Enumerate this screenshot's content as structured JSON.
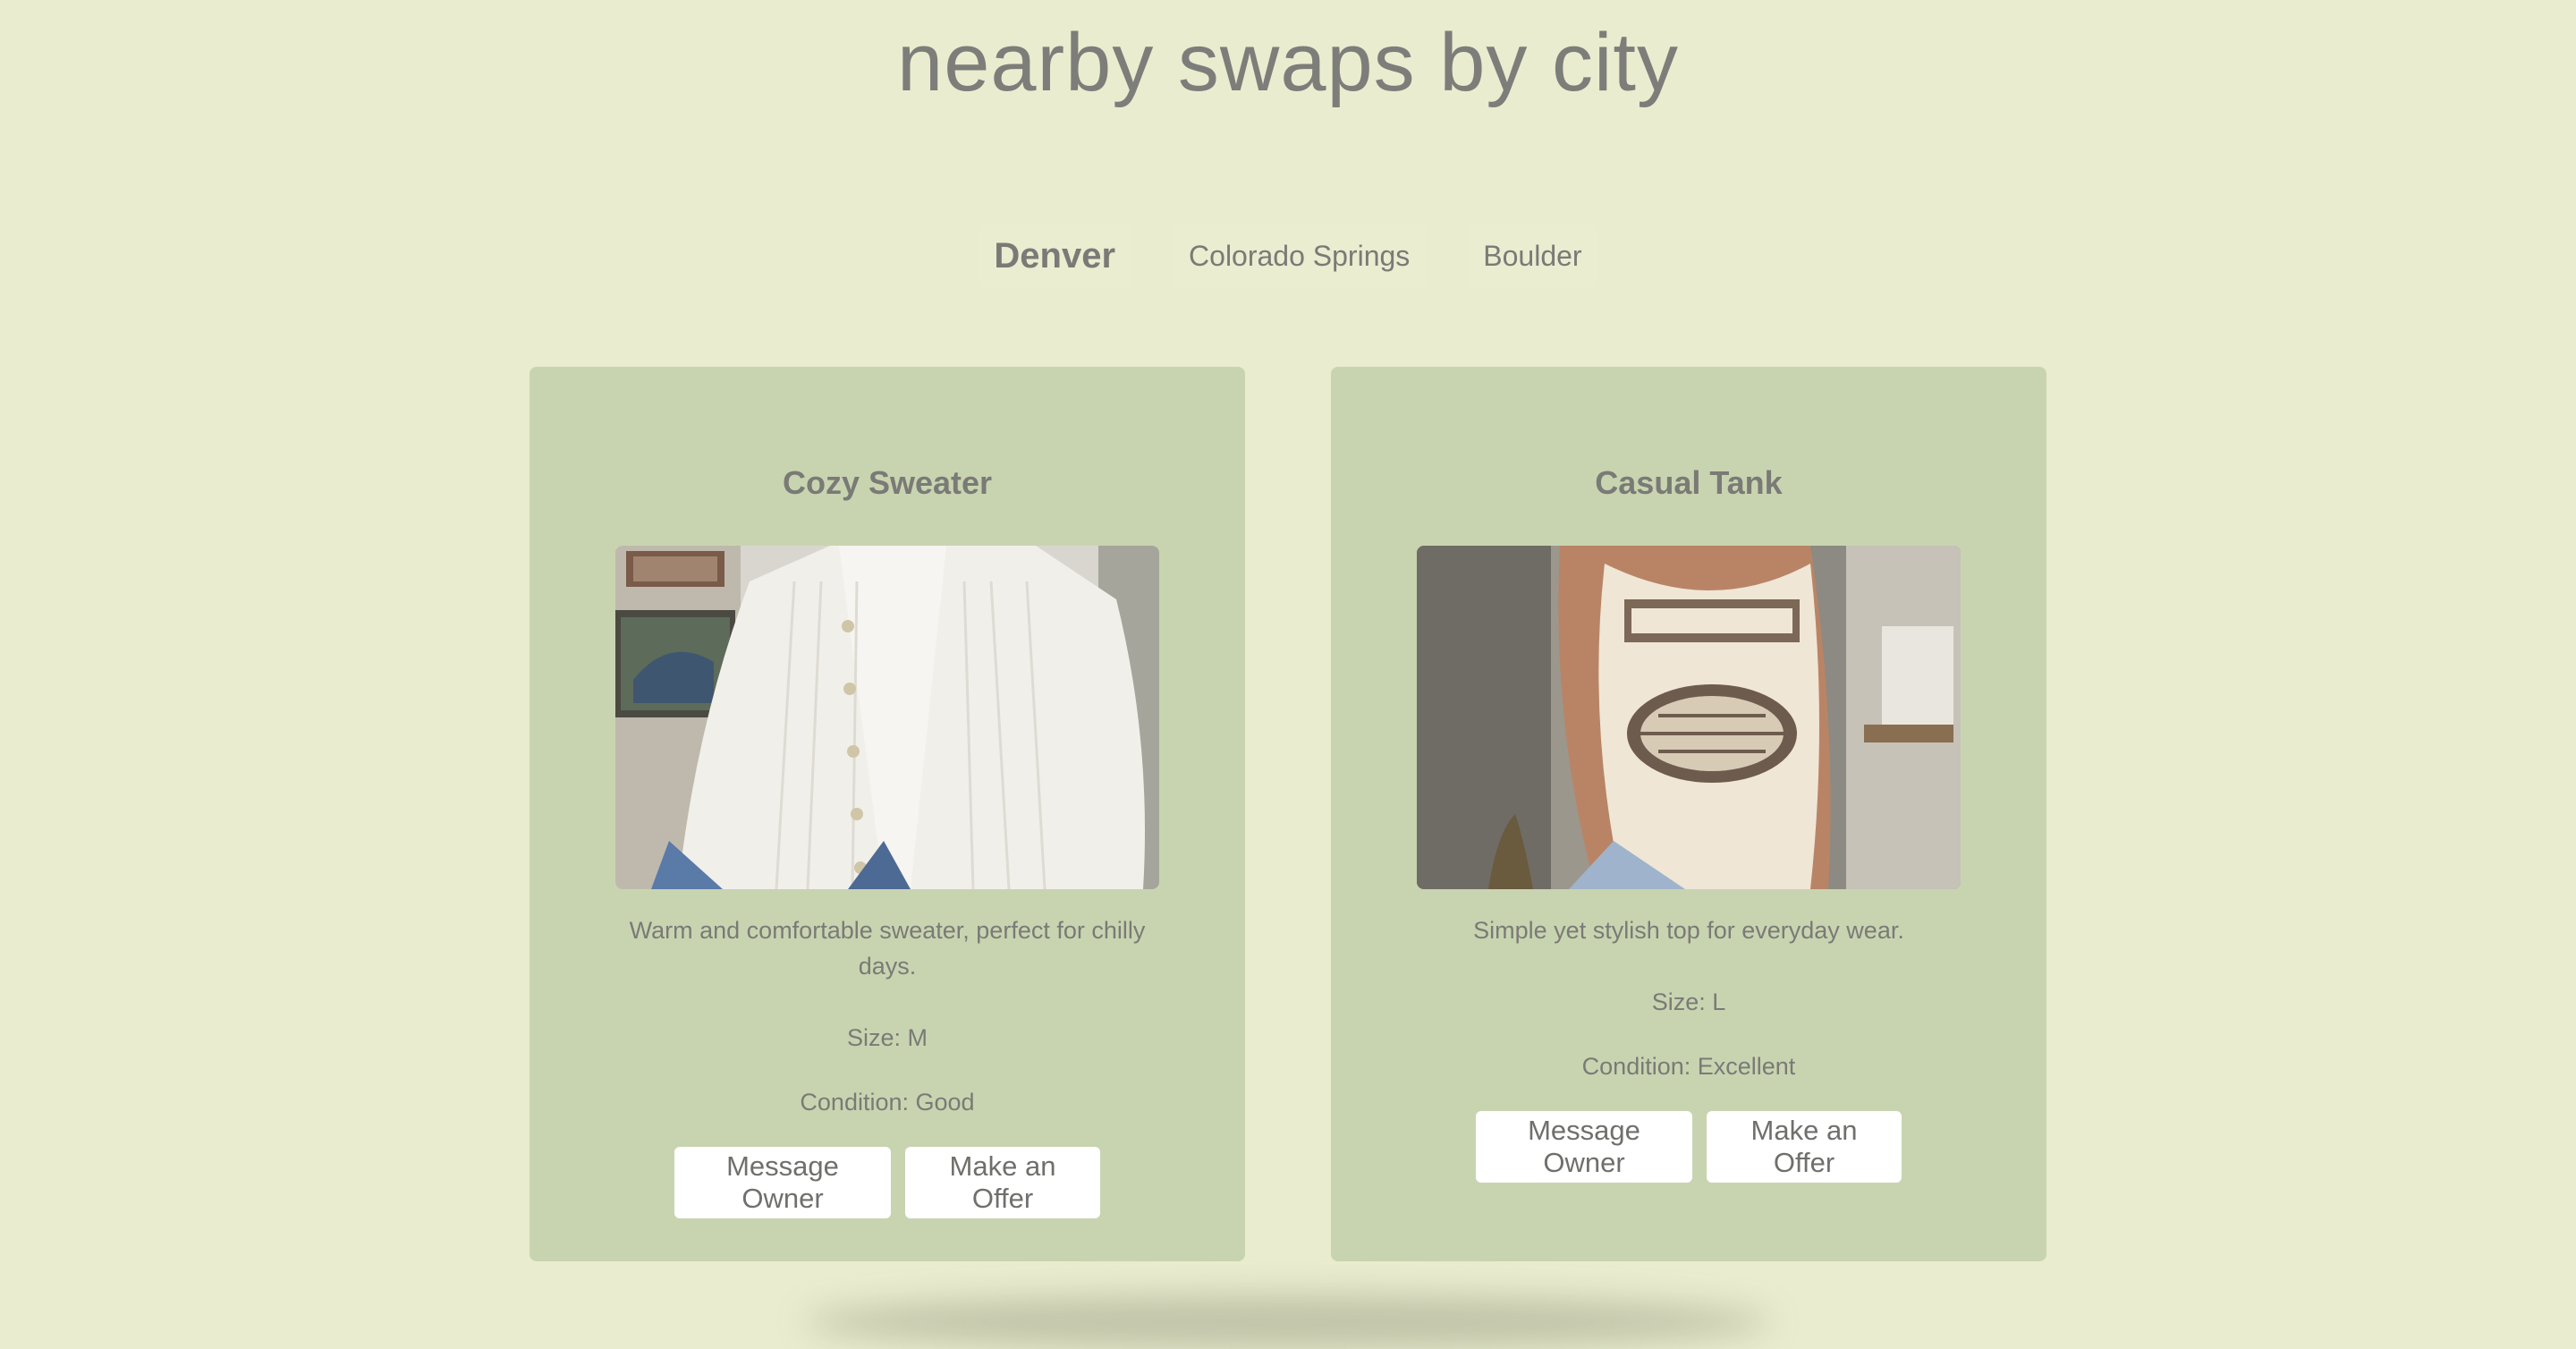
{
  "page": {
    "title": "nearby swaps by city"
  },
  "tabs": [
    {
      "label": "Denver",
      "active": true
    },
    {
      "label": "Colorado Springs",
      "active": false
    },
    {
      "label": "Boulder",
      "active": false
    }
  ],
  "listings": [
    {
      "title": "Cozy Sweater",
      "image_icon": "sweater-photo",
      "description": "Warm and comfortable sweater, perfect for chilly days.",
      "size": "Size: M",
      "condition": "Condition: Good",
      "message_label": "Message Owner",
      "offer_label": "Make an Offer"
    },
    {
      "title": "Casual Tank",
      "image_icon": "tank-top-photo",
      "description": "Simple yet stylish top for everyday wear.",
      "size": "Size: L",
      "condition": "Condition: Excellent",
      "message_label": "Message Owner",
      "offer_label": "Make an Offer"
    }
  ],
  "colors": {
    "background": "#e9ecce",
    "card": "#c8d4b0",
    "text": "#7a7a76",
    "button": "#ffffff"
  }
}
